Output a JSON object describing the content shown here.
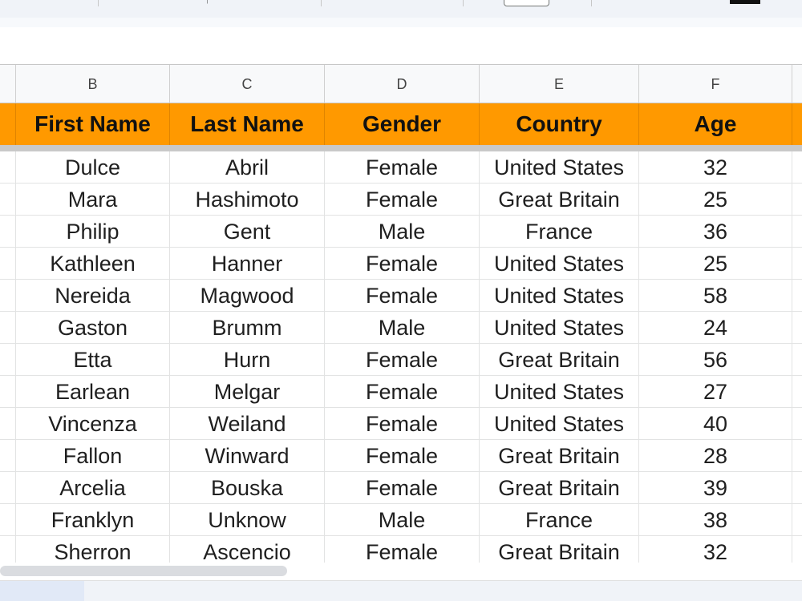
{
  "columns": {
    "letters": [
      "B",
      "C",
      "D",
      "E",
      "F"
    ]
  },
  "header": {
    "first_name": "First Name",
    "last_name": "Last Name",
    "gender": "Gender",
    "country": "Country",
    "age": "Age"
  },
  "rows": [
    {
      "first": "Dulce",
      "last": "Abril",
      "gender": "Female",
      "country": "United States",
      "age": "32"
    },
    {
      "first": "Mara",
      "last": "Hashimoto",
      "gender": "Female",
      "country": "Great Britain",
      "age": "25"
    },
    {
      "first": "Philip",
      "last": "Gent",
      "gender": "Male",
      "country": "France",
      "age": "36"
    },
    {
      "first": "Kathleen",
      "last": "Hanner",
      "gender": "Female",
      "country": "United States",
      "age": "25"
    },
    {
      "first": "Nereida",
      "last": "Magwood",
      "gender": "Female",
      "country": "United States",
      "age": "58"
    },
    {
      "first": "Gaston",
      "last": "Brumm",
      "gender": "Male",
      "country": "United States",
      "age": "24"
    },
    {
      "first": "Etta",
      "last": "Hurn",
      "gender": "Female",
      "country": "Great Britain",
      "age": "56"
    },
    {
      "first": "Earlean",
      "last": "Melgar",
      "gender": "Female",
      "country": "United States",
      "age": "27"
    },
    {
      "first": "Vincenza",
      "last": "Weiland",
      "gender": "Female",
      "country": "United States",
      "age": "40"
    },
    {
      "first": "Fallon",
      "last": "Winward",
      "gender": "Female",
      "country": "Great Britain",
      "age": "28"
    },
    {
      "first": "Arcelia",
      "last": "Bouska",
      "gender": "Female",
      "country": "Great Britain",
      "age": "39"
    },
    {
      "first": "Franklyn",
      "last": "Unknow",
      "gender": "Male",
      "country": "France",
      "age": "38"
    },
    {
      "first": "Sherron",
      "last": "Ascencio",
      "gender": "Female",
      "country": "Great Britain",
      "age": "32"
    }
  ],
  "colors": {
    "header_fill": "#ff9900",
    "grid_line": "#e2e3e3",
    "toolbar_bg": "#f0f3f8"
  }
}
